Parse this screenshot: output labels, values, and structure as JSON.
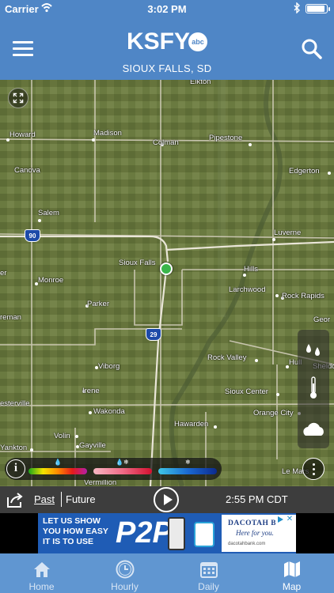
{
  "status_bar": {
    "carrier": "Carrier",
    "time": "3:02 PM"
  },
  "header": {
    "logo": "KSFY",
    "logo_badge": "abc",
    "location": "SIOUX FALLS, SD",
    "color": "#4f86c6"
  },
  "map": {
    "places": {
      "elkton": "Elkton",
      "howard": "Howard",
      "madison": "Madison",
      "colman": "Colman",
      "pipestone": "Pipestone",
      "canova": "Canova",
      "edgerton": "Edgerton",
      "salem": "Salem",
      "luverne": "Luverne",
      "sioux_falls": "Sioux Falls",
      "hills": "Hills",
      "er": "er",
      "monroe": "Monroe",
      "larchwood": "Larchwood",
      "rock_rapids": "Rock Rapids",
      "parker": "Parker",
      "george": "Geor",
      "freeman": "reman",
      "rock_valley": "Rock Valley",
      "hull": "Hull",
      "sheldon": "Sheldo",
      "viborg": "Viborg",
      "irene": "Irene",
      "sioux_center": "Sioux Center",
      "wakonda": "Wakonda",
      "orange_city": "Orange City",
      "centerville": "esterville",
      "hawarden": "Hawarden",
      "volin": "Volin",
      "gayville": "Gayville",
      "yankton": "Yankton",
      "vermillion": "Vermillion",
      "le_mars": "Le Mars"
    },
    "shields": {
      "i90": "90",
      "i29": "29"
    },
    "layers": [
      "radar-drops-icon",
      "thermometer-icon",
      "cloud-icon"
    ]
  },
  "legend": {
    "info": "i",
    "rain_tag": "💧",
    "mix_tag": "💧❄",
    "snow_tag": "❄"
  },
  "timeline": {
    "past": "Past",
    "future": "Future",
    "time": "2:55 PM CDT"
  },
  "ad": {
    "line1": "LET US SHOW",
    "line2": "YOU HOW EASY",
    "line3": "IT IS TO USE",
    "big": "P2P!",
    "bank": "DACOTAH B",
    "tagline": "Here for you.",
    "url": "dacotahbank.com",
    "close": "✕"
  },
  "tabs": [
    {
      "label": "Home",
      "icon": "home-icon"
    },
    {
      "label": "Hourly",
      "icon": "clock-icon"
    },
    {
      "label": "Daily",
      "icon": "calendar-icon"
    },
    {
      "label": "Map",
      "icon": "map-icon"
    }
  ],
  "active_tab": "Map"
}
